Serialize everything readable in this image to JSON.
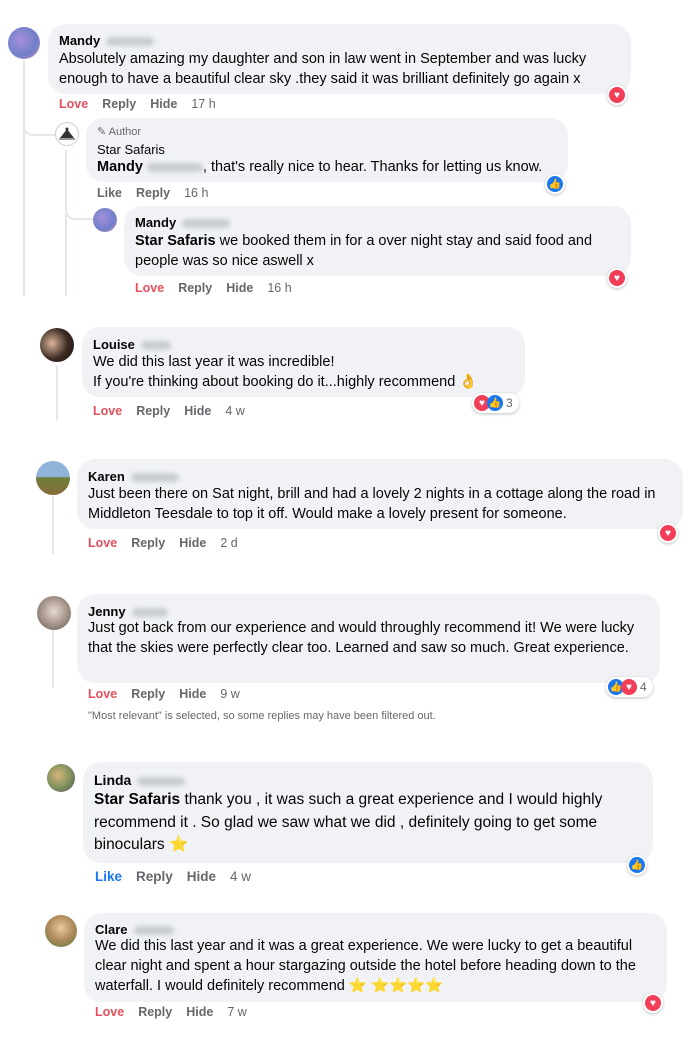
{
  "comments": [
    {
      "name": "Mandy",
      "text": "Absolutely amazing my daughter and son in law went in September and was lucky enough to have a beautiful clear sky .they said it was brilliant definitely go again x",
      "actions": [
        "Love",
        "Reply",
        "Hide"
      ],
      "time": "17 h",
      "reactions": [
        "heart"
      ]
    },
    {
      "author_tag": "Author",
      "name": "Star Safaris",
      "mention": "Mandy",
      "text": ", that's really nice to hear. Thanks for letting us know.",
      "actions": [
        "Like",
        "Reply"
      ],
      "time": "16 h",
      "reactions": [
        "like"
      ]
    },
    {
      "name": "Mandy",
      "mention": "Star Safaris",
      "text": " we booked them in for a over night stay and said food and people was so nice aswell x",
      "actions": [
        "Love",
        "Reply",
        "Hide"
      ],
      "time": "16 h",
      "reactions": [
        "heart"
      ]
    },
    {
      "name": "Louise",
      "text": "We did this last year it was incredible!\nIf you're thinking about booking do it...highly recommend 👌",
      "actions": [
        "Love",
        "Reply",
        "Hide"
      ],
      "time": "4 w",
      "reactions": [
        "heart",
        "like"
      ],
      "reaction_count": "3"
    },
    {
      "name": "Karen",
      "text": "Just been there on Sat night, brill and had a lovely 2 nights in a cottage along the road in Middleton Teesdale to top it off. Would make a lovely present for someone.",
      "actions": [
        "Love",
        "Reply",
        "Hide"
      ],
      "time": "2 d",
      "reactions": [
        "heart"
      ]
    },
    {
      "name": "Jenny",
      "text": "Just got back from our experience and would throughly recommend it! We were lucky that the skies were perfectly clear too. Learned and saw so much. Great experience.",
      "actions": [
        "Love",
        "Reply",
        "Hide"
      ],
      "time": "9 w",
      "reactions": [
        "like",
        "heart"
      ],
      "reaction_count": "4"
    },
    {
      "name": "Linda",
      "mention": "Star Safaris",
      "text": " thank you , it was such a great experience and I would highly recommend it . So glad we saw what we did , definitely going to get some binoculars ⭐",
      "actions": [
        "Like",
        "Reply",
        "Hide"
      ],
      "time": "4 w",
      "reactions": [
        "like"
      ]
    },
    {
      "name": "Clare",
      "text": "We did this last year and it was a great experience. We were lucky to get a beautiful clear night and spent a hour stargazing outside the hotel before heading down to the waterfall. I would definitely recommend ⭐ ⭐⭐⭐⭐",
      "actions": [
        "Love",
        "Reply",
        "Hide"
      ],
      "time": "7 w",
      "reactions": [
        "heart"
      ]
    }
  ],
  "filter_note": "\"Most relevant\" is selected, so some replies may have been filtered out.",
  "colors": {
    "love": "#e4505d",
    "like": "#1877f2",
    "bubble": "#f0f2f5",
    "meta": "#65676b"
  }
}
